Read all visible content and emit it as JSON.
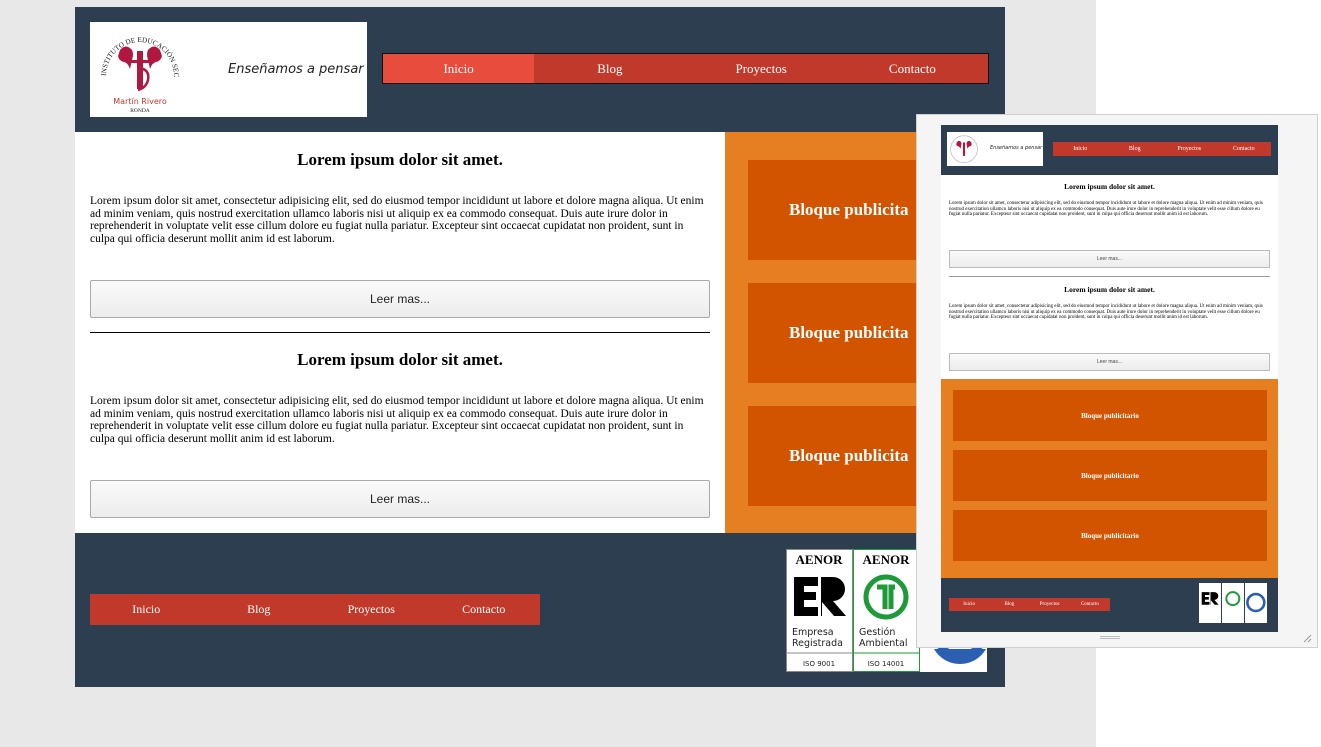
{
  "site": {
    "tagline": "Enseñamos a pensar",
    "logo": {
      "arc_top": "INSTITUTO DE EDUCACIÓN SECUNDARIA",
      "name": "Martín Rivero",
      "town": "RONDA"
    }
  },
  "nav": {
    "items": [
      "Inicio",
      "Blog",
      "Proyectos",
      "Contacto"
    ],
    "active_index": 0
  },
  "articles": [
    {
      "title": "Lorem ipsum dolor sit amet.",
      "body": "Lorem ipsum dolor sit amet, consectetur adipisicing elit, sed do eiusmod tempor incididunt ut labore et dolore magna aliqua. Ut enim ad minim veniam, quis nostrud exercitation ullamco laboris nisi ut aliquip ex ea commodo consequat. Duis aute irure dolor in reprehenderit in voluptate velit esse cillum dolore eu fugiat nulla pariatur. Excepteur sint occaecat cupidatat non proident, sunt in culpa qui officia deserunt mollit anim id est laborum.",
      "button": "Leer mas..."
    },
    {
      "title": "Lorem ipsum dolor sit amet.",
      "body": "Lorem ipsum dolor sit amet, consectetur adipisicing elit, sed do eiusmod tempor incididunt ut labore et dolore magna aliqua. Ut enim ad minim veniam, quis nostrud exercitation ullamco laboris nisi ut aliquip ex ea commodo consequat. Duis aute irure dolor in reprehenderit in voluptate velit esse cillum dolore eu fugiat nulla pariatur. Excepteur sint occaecat cupidatat non proident, sunt in culpa qui officia deserunt mollit anim id est laborum.",
      "button": "Leer mas..."
    }
  ],
  "ads": {
    "main_label": "Bloque publicita",
    "preview_label": "Bloque publicitario"
  },
  "certifications": [
    {
      "brand": "AENOR",
      "line1": "Empresa",
      "line2": "Registrada",
      "code": "ISO 9001"
    },
    {
      "brand": "AENOR",
      "line1": "Gestión",
      "line2": "Ambiental",
      "code": "ISO 14001"
    }
  ],
  "colors": {
    "dark": "#2c3e50",
    "nav_red": "#c0392b",
    "nav_active": "#e74c3c",
    "aside_orange": "#e67e22",
    "ad_orange": "#d35400",
    "cert_green": "#1f9a3a",
    "cert_blue": "#2b5fb3"
  }
}
